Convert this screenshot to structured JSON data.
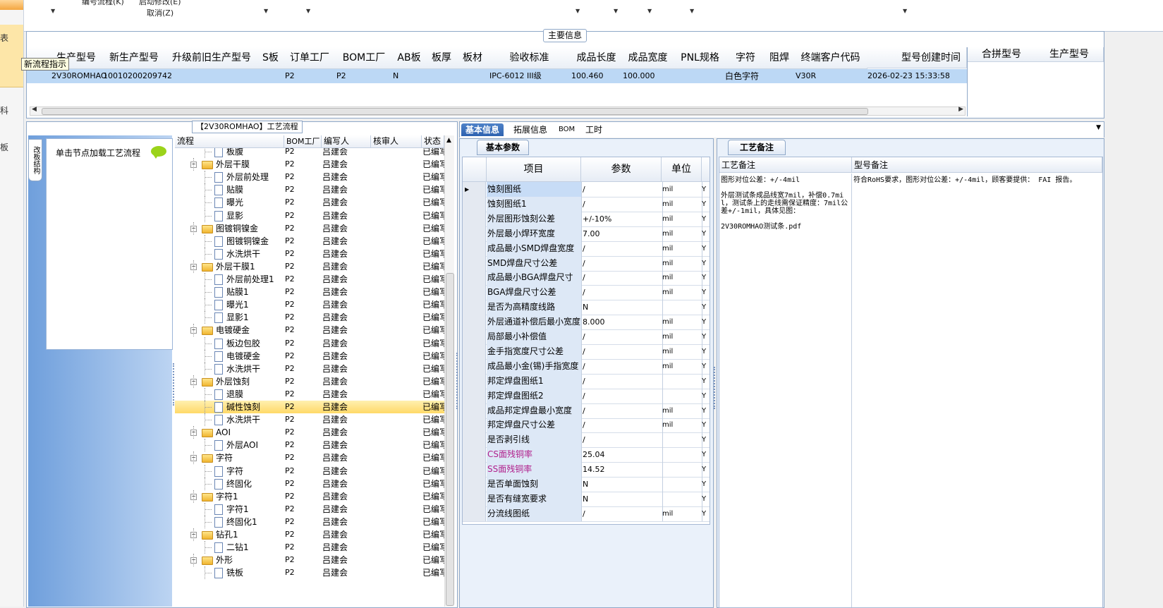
{
  "left_strip": {
    "chars": [
      "表",
      "科",
      "板"
    ]
  },
  "top_bar": {
    "line1_left": "编号流程(K)",
    "line1_right": "启动修改(E)",
    "line2": "取消(Z)"
  },
  "main_info": {
    "title": "主要信息",
    "tooltip": "新流程指示",
    "columns": [
      "生产型号",
      "新生产型号",
      "升级前旧生产型号",
      "S板",
      "订单工厂",
      "BOM工厂",
      "AB板",
      "板厚",
      "板材",
      "验收标准",
      "成品长度",
      "成品宽度",
      "PNL规格",
      "字符",
      "阻焊",
      "终端客户代码",
      "型号创建时间"
    ],
    "row": {
      "model": "2V30ROMHAO",
      "new_model": "10010200209742",
      "order_factory": "P2",
      "bom_factory": "P2",
      "ab_board": "N",
      "standard": "IPC-6012 III级",
      "length": "100.460",
      "width": "100.000",
      "char": "白色字符",
      "customer_code": "V30R",
      "created": "2026-02-23 15:33:58"
    },
    "merge_columns": [
      "合拼型号",
      "生产型号"
    ]
  },
  "tree_panel": {
    "title": "【2V30ROMHAO】工艺流程",
    "side_tab": "改板结构",
    "hint": "单击节点加载工艺流程",
    "columns": [
      "流程",
      "BOM工厂",
      "编写人",
      "核审人",
      "状态"
    ],
    "rows": [
      {
        "name": "板腹",
        "level": 2,
        "bom": "P2",
        "author": "吕建会",
        "status": "已编写"
      },
      {
        "name": "外层干膜",
        "level": 1,
        "bom": "P2",
        "author": "吕建会",
        "status": "已编写"
      },
      {
        "name": "外层前处理",
        "level": 2,
        "bom": "P2",
        "author": "吕建会",
        "status": "已编写"
      },
      {
        "name": "贴膜",
        "level": 2,
        "bom": "P2",
        "author": "吕建会",
        "status": "已编写"
      },
      {
        "name": "曝光",
        "level": 2,
        "bom": "P2",
        "author": "吕建会",
        "status": "已编写"
      },
      {
        "name": "显影",
        "level": 2,
        "bom": "P2",
        "author": "吕建会",
        "status": "已编写"
      },
      {
        "name": "图镀铜镍金",
        "level": 1,
        "bom": "P2",
        "author": "吕建会",
        "status": "已编写"
      },
      {
        "name": "图镀铜镍金",
        "level": 2,
        "bom": "P2",
        "author": "吕建会",
        "status": "已编写"
      },
      {
        "name": "水洗烘干",
        "level": 2,
        "bom": "P2",
        "author": "吕建会",
        "status": "已编写"
      },
      {
        "name": "外层干膜1",
        "level": 1,
        "bom": "P2",
        "author": "吕建会",
        "status": "已编写"
      },
      {
        "name": "外层前处理1",
        "level": 2,
        "bom": "P2",
        "author": "吕建会",
        "status": "已编写"
      },
      {
        "name": "贴膜1",
        "level": 2,
        "bom": "P2",
        "author": "吕建会",
        "status": "已编写"
      },
      {
        "name": "曝光1",
        "level": 2,
        "bom": "P2",
        "author": "吕建会",
        "status": "已编写"
      },
      {
        "name": "显影1",
        "level": 2,
        "bom": "P2",
        "author": "吕建会",
        "status": "已编写"
      },
      {
        "name": "电镀硬金",
        "level": 1,
        "bom": "P2",
        "author": "吕建会",
        "status": "已编写"
      },
      {
        "name": "板边包胶",
        "level": 2,
        "bom": "P2",
        "author": "吕建会",
        "status": "已编写"
      },
      {
        "name": "电镀硬金",
        "level": 2,
        "bom": "P2",
        "author": "吕建会",
        "status": "已编写"
      },
      {
        "name": "水洗烘干",
        "level": 2,
        "bom": "P2",
        "author": "吕建会",
        "status": "已编写"
      },
      {
        "name": "外层蚀刻",
        "level": 1,
        "bom": "P2",
        "author": "吕建会",
        "status": "已编写"
      },
      {
        "name": "退膜",
        "level": 2,
        "bom": "P2",
        "author": "吕建会",
        "status": "已编写"
      },
      {
        "name": "碱性蚀刻",
        "level": 2,
        "bom": "P2",
        "author": "吕建会",
        "status": "已编写",
        "highlight": true
      },
      {
        "name": "水洗烘干",
        "level": 2,
        "bom": "P2",
        "author": "吕建会",
        "status": "已编写"
      },
      {
        "name": "AOI",
        "level": 1,
        "bom": "P2",
        "author": "吕建会",
        "status": "已编写"
      },
      {
        "name": "外层AOI",
        "level": 2,
        "bom": "P2",
        "author": "吕建会",
        "status": "已编写"
      },
      {
        "name": "字符",
        "level": 1,
        "bom": "P2",
        "author": "吕建会",
        "status": "已编写"
      },
      {
        "name": "字符",
        "level": 2,
        "bom": "P2",
        "author": "吕建会",
        "status": "已编写"
      },
      {
        "name": "终固化",
        "level": 2,
        "bom": "P2",
        "author": "吕建会",
        "status": "已编写"
      },
      {
        "name": "字符1",
        "level": 1,
        "bom": "P2",
        "author": "吕建会",
        "status": "已编写"
      },
      {
        "name": "字符1",
        "level": 2,
        "bom": "P2",
        "author": "吕建会",
        "status": "已编写"
      },
      {
        "name": "终固化1",
        "level": 2,
        "bom": "P2",
        "author": "吕建会",
        "status": "已编写"
      },
      {
        "name": "钻孔1",
        "level": 1,
        "bom": "P2",
        "author": "吕建会",
        "status": "已编写"
      },
      {
        "name": "二钻1",
        "level": 2,
        "bom": "P2",
        "author": "吕建会",
        "status": "已编写"
      },
      {
        "name": "外形",
        "level": 1,
        "bom": "P2",
        "author": "吕建会",
        "status": "已编写"
      },
      {
        "name": "铣板",
        "level": 2,
        "bom": "P2",
        "author": "吕建会",
        "status": "已编写"
      }
    ]
  },
  "tabs": [
    "基本信息",
    "拓展信息",
    "BOM",
    "工时"
  ],
  "params": {
    "title": "基本参数",
    "columns": [
      "项目",
      "参数",
      "单位"
    ],
    "rows": [
      {
        "item": "蚀刻图纸",
        "value": "/",
        "unit": "mil",
        "flag": "Y",
        "selected": true
      },
      {
        "item": "蚀刻图纸1",
        "value": "/",
        "unit": "mil",
        "flag": "Y"
      },
      {
        "item": "外层图形蚀刻公差",
        "value": "+/-10%",
        "unit": "mil",
        "flag": "Y"
      },
      {
        "item": "外层最小焊环宽度",
        "value": "7.00",
        "unit": "mil",
        "flag": "Y"
      },
      {
        "item": "成品最小SMD焊盘宽度",
        "value": "/",
        "unit": "mil",
        "flag": "Y"
      },
      {
        "item": "SMD焊盘尺寸公差",
        "value": "/",
        "unit": "mil",
        "flag": "Y"
      },
      {
        "item": "成品最小BGA焊盘尺寸",
        "value": "/",
        "unit": "mil",
        "flag": "Y"
      },
      {
        "item": "BGA焊盘尺寸公差",
        "value": "/",
        "unit": "mil",
        "flag": "Y"
      },
      {
        "item": "是否为高精度线路",
        "value": "N",
        "unit": "",
        "flag": "Y"
      },
      {
        "item": "外层通道补偿后最小宽度",
        "value": "8.000",
        "unit": "mil",
        "flag": "Y"
      },
      {
        "item": "局部最小补偿值",
        "value": "/",
        "unit": "mil",
        "flag": "Y"
      },
      {
        "item": "金手指宽度尺寸公差",
        "value": "/",
        "unit": "mil",
        "flag": "Y"
      },
      {
        "item": "成品最小金(锡)手指宽度",
        "value": "/",
        "unit": "mil",
        "flag": "Y"
      },
      {
        "item": "邦定焊盘图纸1",
        "value": "/",
        "unit": "",
        "flag": "Y"
      },
      {
        "item": "邦定焊盘图纸2",
        "value": "/",
        "unit": "",
        "flag": "Y"
      },
      {
        "item": "成品邦定焊盘最小宽度",
        "value": "/",
        "unit": "mil",
        "flag": "Y"
      },
      {
        "item": "邦定焊盘尺寸公差",
        "value": "/",
        "unit": "mil",
        "flag": "Y"
      },
      {
        "item": "是否剥引线",
        "value": "/",
        "unit": "",
        "flag": "Y"
      },
      {
        "item": "CS面残铜率",
        "value": "25.04",
        "unit": "",
        "flag": "Y",
        "pink": true
      },
      {
        "item": "SS面残铜率",
        "value": "14.52",
        "unit": "",
        "flag": "Y",
        "pink": true
      },
      {
        "item": "是否单面蚀刻",
        "value": "N",
        "unit": "",
        "flag": "Y"
      },
      {
        "item": "是否有缝宽要求",
        "value": "N",
        "unit": "",
        "flag": "Y"
      },
      {
        "item": "分流线图纸",
        "value": "/",
        "unit": "mil",
        "flag": "Y"
      }
    ]
  },
  "notes": {
    "title": "工艺备注",
    "col1_header": "工艺备注",
    "col2_header": "型号备注",
    "col1_text": "图形对位公差：+/-4mil\n\n外层测试条成品线宽7mil，补偿0.7mil，测试条上的走线需保证精度：7mil公差+/-1mil，具体见图：\n\n2V30ROMHAO测试条.pdf",
    "col2_text": "符合RoHS要求，图形对位公差：+/-4mil，顾客要提供： FAI 报告。"
  }
}
